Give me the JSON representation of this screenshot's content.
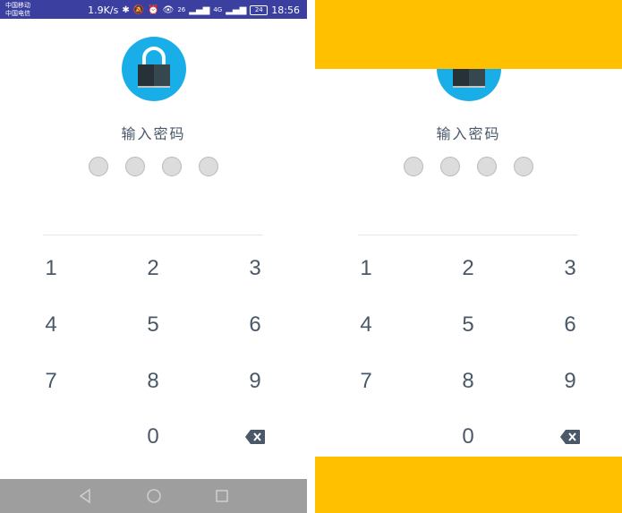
{
  "status_bar": {
    "carrier_1": "中国移动",
    "carrier_2": "中国电信",
    "speed": "1.9K/s",
    "network_1": "26",
    "network_2": "4G",
    "battery": "24",
    "time": "18:56"
  },
  "left_screen": {
    "title": "输入密码",
    "keys": [
      "1",
      "2",
      "3",
      "4",
      "5",
      "6",
      "7",
      "8",
      "9",
      "0"
    ]
  },
  "right_screen": {
    "title": "输入密码",
    "keys": [
      "1",
      "2",
      "3",
      "4",
      "5",
      "6",
      "7",
      "8",
      "9",
      "0"
    ]
  },
  "colors": {
    "accent": "#1aaee8",
    "lock_body": "#263238",
    "overlay": "#ffc000",
    "status_bar": "#3b3fa0",
    "nav_bar": "#9e9e9e",
    "text": "#4a5868"
  },
  "icons": {
    "lock": "lock-icon",
    "backspace": "backspace-icon",
    "nav_back": "back-triangle-icon",
    "nav_home": "home-circle-icon",
    "nav_recent": "recent-square-icon"
  }
}
